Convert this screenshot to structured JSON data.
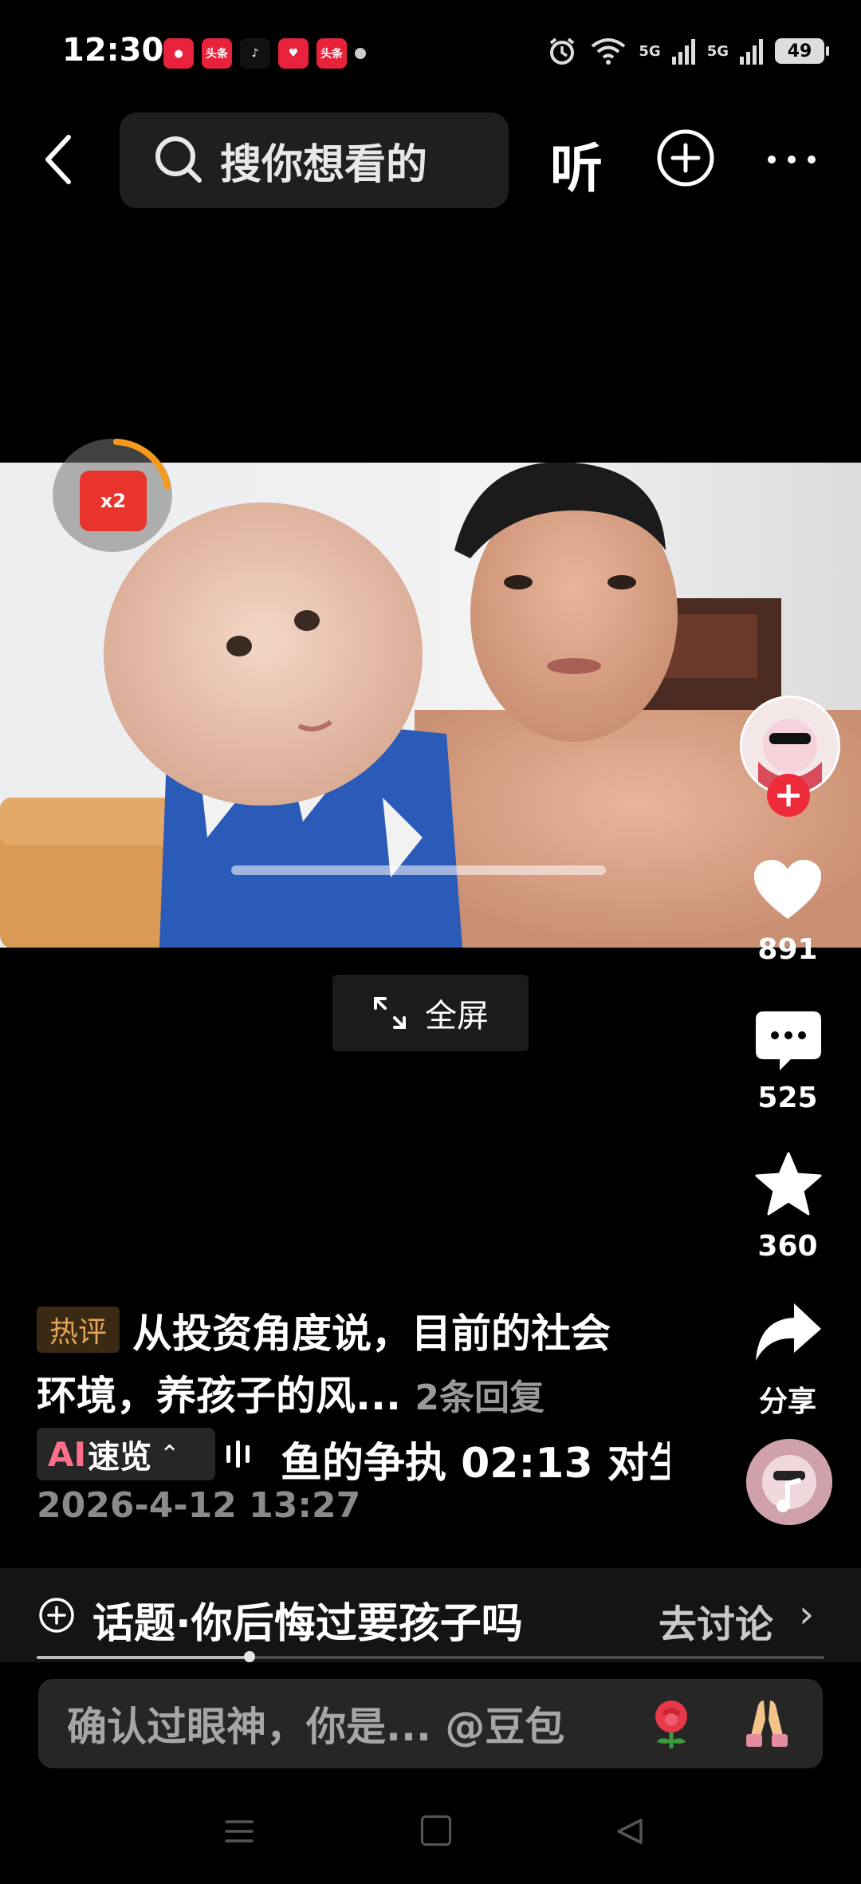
{
  "status_bar": {
    "time": "12:30",
    "apps": [
      "头条",
      "头条",
      "头条"
    ],
    "battery": "49",
    "network": "5G"
  },
  "top_bar": {
    "search_placeholder": "搜你想看的",
    "listen_label": "听"
  },
  "video": {
    "fullscreen_label": "全屏",
    "reward_badge": "x2"
  },
  "side_rail": {
    "like_count": "891",
    "comment_count": "525",
    "favorite_count": "360",
    "share_label": "分享"
  },
  "caption": {
    "hot_tag": "热评",
    "hot_comment_line1": "从投资角度说，目前的社会",
    "hot_comment_line2": "环境，养孩子的风...",
    "reply_count": "2条回复",
    "ai_label": "AI",
    "ai_text": "速览",
    "ai_summary": "鱼的争执   02:13 对生",
    "date": "2026-4-12 13:27"
  },
  "topic": {
    "text": "话题·你后悔过要孩子吗",
    "action": "去讨论"
  },
  "progress": {
    "fraction": 0.27
  },
  "comment_input": {
    "placeholder": "确认过眼神，你是... @豆包"
  },
  "colors": {
    "accent_red": "#ee2b3a",
    "hot_tag": "#e2a354",
    "ai_pink": "#ff6f8a"
  }
}
